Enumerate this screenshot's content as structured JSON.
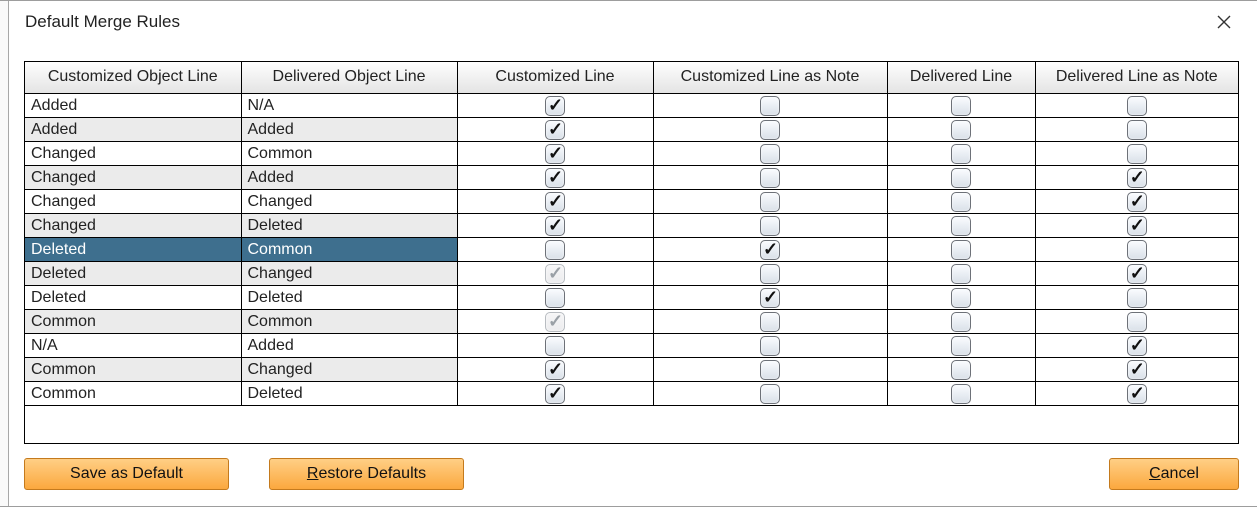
{
  "title": "Default Merge Rules",
  "columns": [
    "Customized Object Line",
    "Delivered Object Line",
    "Customized Line",
    "Customized Line as Note",
    "Delivered Line",
    "Delivered Line as Note"
  ],
  "rows": [
    {
      "custObj": "Added",
      "delObj": "N/A",
      "cLine": {
        "checked": true,
        "disabled": false
      },
      "cNote": {
        "checked": false,
        "disabled": false
      },
      "dLine": {
        "checked": false,
        "disabled": false
      },
      "dNote": {
        "checked": false,
        "disabled": false
      },
      "stripe": false,
      "selected": false
    },
    {
      "custObj": "Added",
      "delObj": "Added",
      "cLine": {
        "checked": true,
        "disabled": false
      },
      "cNote": {
        "checked": false,
        "disabled": false
      },
      "dLine": {
        "checked": false,
        "disabled": false
      },
      "dNote": {
        "checked": false,
        "disabled": false
      },
      "stripe": true,
      "selected": false
    },
    {
      "custObj": "Changed",
      "delObj": "Common",
      "cLine": {
        "checked": true,
        "disabled": false
      },
      "cNote": {
        "checked": false,
        "disabled": false
      },
      "dLine": {
        "checked": false,
        "disabled": false
      },
      "dNote": {
        "checked": false,
        "disabled": false
      },
      "stripe": false,
      "selected": false
    },
    {
      "custObj": "Changed",
      "delObj": "Added",
      "cLine": {
        "checked": true,
        "disabled": false
      },
      "cNote": {
        "checked": false,
        "disabled": false
      },
      "dLine": {
        "checked": false,
        "disabled": false
      },
      "dNote": {
        "checked": true,
        "disabled": false
      },
      "stripe": true,
      "selected": false
    },
    {
      "custObj": "Changed",
      "delObj": "Changed",
      "cLine": {
        "checked": true,
        "disabled": false
      },
      "cNote": {
        "checked": false,
        "disabled": false
      },
      "dLine": {
        "checked": false,
        "disabled": false
      },
      "dNote": {
        "checked": true,
        "disabled": false
      },
      "stripe": false,
      "selected": false
    },
    {
      "custObj": "Changed",
      "delObj": "Deleted",
      "cLine": {
        "checked": true,
        "disabled": false
      },
      "cNote": {
        "checked": false,
        "disabled": false
      },
      "dLine": {
        "checked": false,
        "disabled": false
      },
      "dNote": {
        "checked": true,
        "disabled": false
      },
      "stripe": true,
      "selected": false
    },
    {
      "custObj": "Deleted",
      "delObj": "Common",
      "cLine": {
        "checked": false,
        "disabled": false
      },
      "cNote": {
        "checked": true,
        "disabled": false
      },
      "dLine": {
        "checked": false,
        "disabled": false
      },
      "dNote": {
        "checked": false,
        "disabled": false
      },
      "stripe": false,
      "selected": true
    },
    {
      "custObj": "Deleted",
      "delObj": "Changed",
      "cLine": {
        "checked": true,
        "disabled": true
      },
      "cNote": {
        "checked": false,
        "disabled": false
      },
      "dLine": {
        "checked": false,
        "disabled": false
      },
      "dNote": {
        "checked": true,
        "disabled": false
      },
      "stripe": true,
      "selected": false
    },
    {
      "custObj": "Deleted",
      "delObj": "Deleted",
      "cLine": {
        "checked": false,
        "disabled": false
      },
      "cNote": {
        "checked": true,
        "disabled": false
      },
      "dLine": {
        "checked": false,
        "disabled": false
      },
      "dNote": {
        "checked": false,
        "disabled": false
      },
      "stripe": false,
      "selected": false
    },
    {
      "custObj": "Common",
      "delObj": "Common",
      "cLine": {
        "checked": true,
        "disabled": true
      },
      "cNote": {
        "checked": false,
        "disabled": false
      },
      "dLine": {
        "checked": false,
        "disabled": false
      },
      "dNote": {
        "checked": false,
        "disabled": false
      },
      "stripe": true,
      "selected": false
    },
    {
      "custObj": "N/A",
      "delObj": "Added",
      "cLine": {
        "checked": false,
        "disabled": false
      },
      "cNote": {
        "checked": false,
        "disabled": false
      },
      "dLine": {
        "checked": false,
        "disabled": false
      },
      "dNote": {
        "checked": true,
        "disabled": false
      },
      "stripe": false,
      "selected": false
    },
    {
      "custObj": "Common",
      "delObj": "Changed",
      "cLine": {
        "checked": true,
        "disabled": false
      },
      "cNote": {
        "checked": false,
        "disabled": false
      },
      "dLine": {
        "checked": false,
        "disabled": false
      },
      "dNote": {
        "checked": true,
        "disabled": false
      },
      "stripe": true,
      "selected": false
    },
    {
      "custObj": "Common",
      "delObj": "Deleted",
      "cLine": {
        "checked": true,
        "disabled": false
      },
      "cNote": {
        "checked": false,
        "disabled": false
      },
      "dLine": {
        "checked": false,
        "disabled": false
      },
      "dNote": {
        "checked": true,
        "disabled": false
      },
      "stripe": false,
      "selected": false
    }
  ],
  "buttons": {
    "save": {
      "label": "Save as Default"
    },
    "restore": {
      "prefix": "R",
      "rest": "estore Defaults"
    },
    "cancel": {
      "prefix": "C",
      "rest": "ancel"
    }
  }
}
